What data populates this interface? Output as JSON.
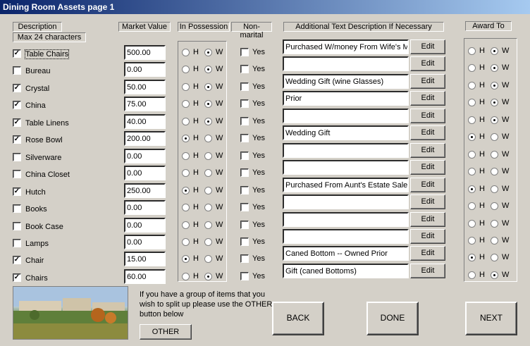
{
  "window": {
    "title": "Dining Room Assets page 1"
  },
  "headers": {
    "description": "Description",
    "max_chars": "Max 24 characters",
    "market_value": "Market Value",
    "in_possession": "In Possession",
    "non_marital": "Non-marital",
    "additional_text": "Additional Text  Description If Necessary",
    "award_to": "Award To"
  },
  "labels": {
    "h": "H",
    "w": "W",
    "yes": "Yes",
    "edit": "Edit"
  },
  "items": [
    {
      "checked": true,
      "description": "Table Chairs",
      "value": "500.00",
      "possession": "W",
      "nonmarital": false,
      "additional": "Purchased W/money From Wife's M",
      "award": "W"
    },
    {
      "checked": false,
      "description": "Bureau",
      "value": "0.00",
      "possession": "W",
      "nonmarital": false,
      "additional": "",
      "award": "W"
    },
    {
      "checked": true,
      "description": "Crystal",
      "value": "50.00",
      "possession": "W",
      "nonmarital": false,
      "additional": "Wedding Gift (wine Glasses)",
      "award": "W"
    },
    {
      "checked": true,
      "description": "China",
      "value": "75.00",
      "possession": "W",
      "nonmarital": false,
      "additional": "Prior",
      "award": "W"
    },
    {
      "checked": true,
      "description": "Table Linens",
      "value": "40.00",
      "possession": "W",
      "nonmarital": false,
      "additional": "",
      "award": "W"
    },
    {
      "checked": true,
      "description": "Rose Bowl",
      "value": "200.00",
      "possession": "H",
      "nonmarital": false,
      "additional": "Wedding Gift",
      "award": "H"
    },
    {
      "checked": false,
      "description": "Silverware",
      "value": "0.00",
      "possession": "",
      "nonmarital": false,
      "additional": "",
      "award": ""
    },
    {
      "checked": false,
      "description": "China Closet",
      "value": "0.00",
      "possession": "",
      "nonmarital": false,
      "additional": "",
      "award": ""
    },
    {
      "checked": true,
      "description": "Hutch",
      "value": "250.00",
      "possession": "H",
      "nonmarital": false,
      "additional": "Purchased From Aunt's Estate Sale",
      "award": "H"
    },
    {
      "checked": false,
      "description": "Books",
      "value": "0.00",
      "possession": "",
      "nonmarital": false,
      "additional": "",
      "award": ""
    },
    {
      "checked": false,
      "description": "Book Case",
      "value": "0.00",
      "possession": "",
      "nonmarital": false,
      "additional": "",
      "award": ""
    },
    {
      "checked": false,
      "description": "Lamps",
      "value": "0.00",
      "possession": "",
      "nonmarital": false,
      "additional": "",
      "award": ""
    },
    {
      "checked": true,
      "description": "Chair",
      "value": "15.00",
      "possession": "H",
      "nonmarital": false,
      "additional": "Caned Bottom -- Owned Prior",
      "award": "H"
    },
    {
      "checked": true,
      "description": "Chairs",
      "value": "60.00",
      "possession": "W",
      "nonmarital": false,
      "additional": "Gift (caned Bottoms)",
      "award": "W"
    }
  ],
  "footer": {
    "note": "If you have a group of items that you wish to split up please use the OTHER button below",
    "other": "OTHER",
    "back": "BACK",
    "done": "DONE",
    "next": "NEXT"
  }
}
